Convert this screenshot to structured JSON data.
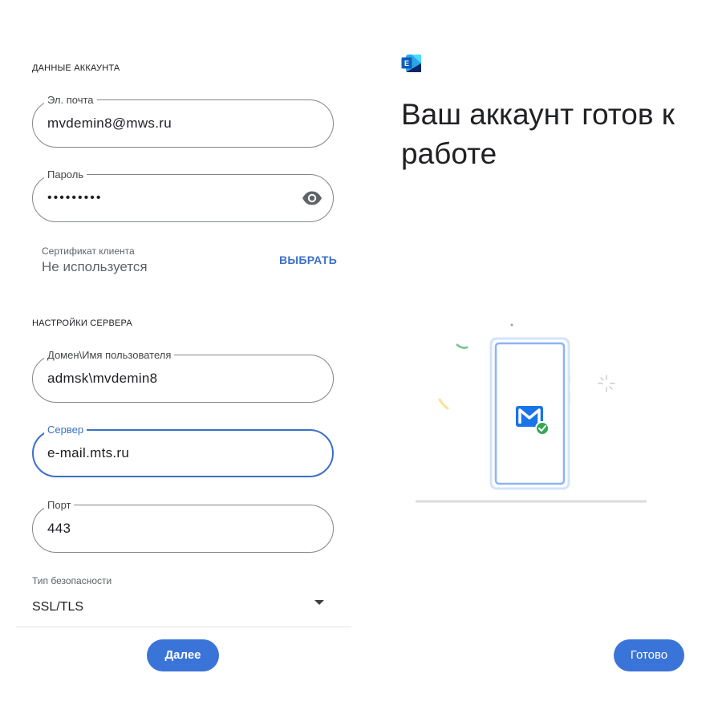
{
  "account": {
    "section_title": "ДАННЫЕ АККАУНТА",
    "email": {
      "label": "Эл. почта",
      "value": "mvdemin8@mws.ru"
    },
    "password": {
      "label": "Пароль",
      "value": "•••••••••"
    },
    "certificate": {
      "label": "Сертификат клиента",
      "value": "Не используется",
      "action_label": "ВЫБРАТЬ"
    }
  },
  "server": {
    "section_title": "НАСТРОЙКИ СЕРВЕРА",
    "username": {
      "label": "Домен\\Имя пользователя",
      "value": "admsk\\mvdemin8"
    },
    "server": {
      "label": "Сервер",
      "value": "e-mail.mts.ru"
    },
    "port": {
      "label": "Порт",
      "value": "443"
    },
    "security": {
      "label": "Тип безопасности",
      "value": "SSL/TLS"
    }
  },
  "left_footer": {
    "next_label": "Далее"
  },
  "right": {
    "logo_icon": "exchange-logo-icon",
    "headline": "Ваш аккаунт готов к работе",
    "done_label": "Готово"
  },
  "colors": {
    "accent": "#3a74d8",
    "focus": "#3a70c8",
    "success": "#34a853"
  }
}
